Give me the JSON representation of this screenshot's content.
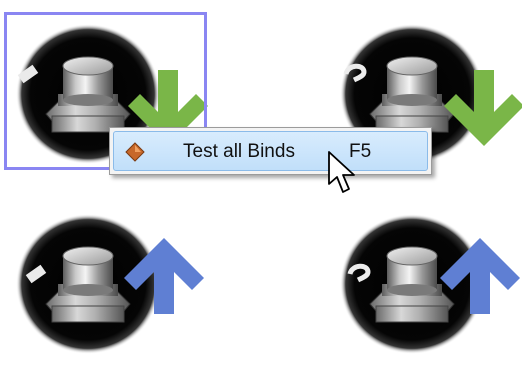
{
  "context_menu": {
    "items": [
      {
        "label": "Test all Binds",
        "shortcut": "F5",
        "icon": "diamond-icon"
      }
    ]
  },
  "switches": [
    {
      "name": "switch-1",
      "mode": "1",
      "direction": "down",
      "arrow_color": "#7ab648",
      "selected": true
    },
    {
      "name": "switch-2",
      "mode": "2",
      "direction": "down",
      "arrow_color": "#7ab648",
      "selected": false
    },
    {
      "name": "switch-1",
      "mode": "1",
      "direction": "up",
      "arrow_color": "#5f7fd3",
      "selected": false
    },
    {
      "name": "switch-2",
      "mode": "2",
      "direction": "up",
      "arrow_color": "#5f7fd3",
      "selected": false
    }
  ],
  "colors": {
    "selection_border": "#8a86f2",
    "menu_highlight": "#c8e3fb",
    "down_arrow": "#7ab648",
    "up_arrow": "#5f7fd3"
  }
}
